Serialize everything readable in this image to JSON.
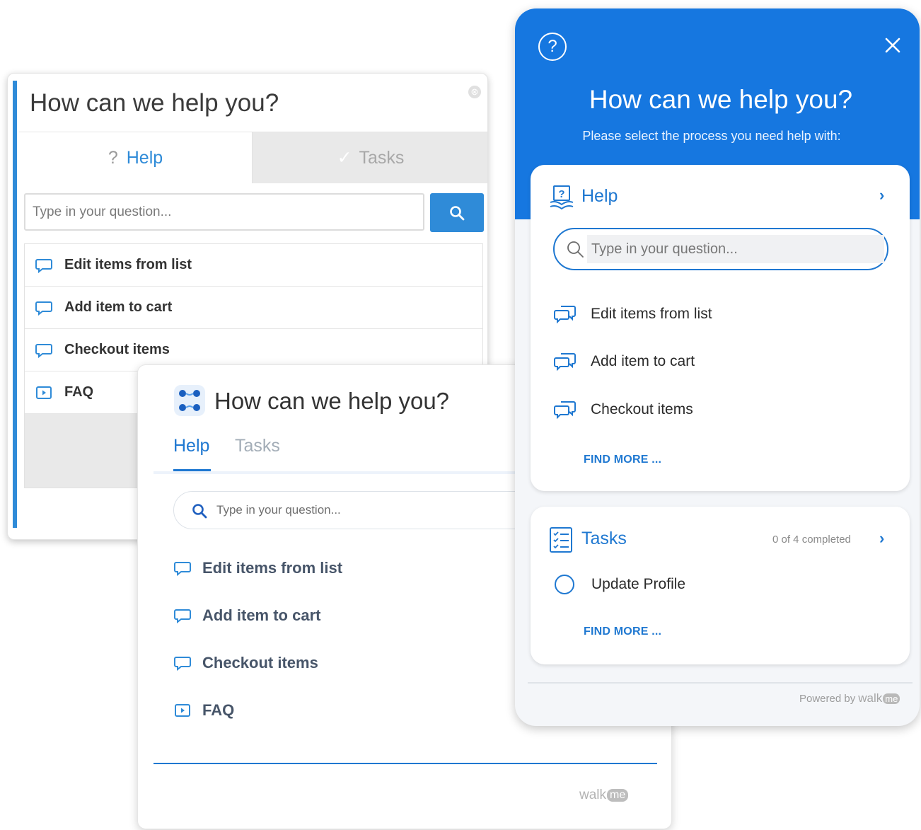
{
  "panel_classic": {
    "title": "How can we help you?",
    "close_glyph": "⊗",
    "tabs": {
      "help": {
        "icon": "?",
        "label": "Help"
      },
      "tasks": {
        "icon": "✓",
        "label": "Tasks"
      }
    },
    "search": {
      "placeholder": "Type in your question..."
    },
    "items": [
      {
        "label": "Edit items from list",
        "icon": "chat-bubble-icon"
      },
      {
        "label": "Add item to cart",
        "icon": "chat-bubble-icon"
      },
      {
        "label": "Checkout items",
        "icon": "chat-bubble-icon"
      },
      {
        "label": "FAQ",
        "icon": "play-box-icon"
      }
    ],
    "colors": {
      "accent": "#2f8bd8"
    }
  },
  "panel_modern": {
    "title": "How can we help you?",
    "tabs": {
      "help": "Help",
      "tasks": "Tasks"
    },
    "search": {
      "placeholder": "Type in your question..."
    },
    "items": [
      {
        "label": "Edit items from list",
        "icon": "chat-bubble-icon"
      },
      {
        "label": "Add item to cart",
        "icon": "chat-bubble-icon"
      },
      {
        "label": "Checkout items",
        "icon": "chat-bubble-icon"
      },
      {
        "label": "FAQ",
        "icon": "play-box-icon"
      }
    ],
    "brand": {
      "walk": "walk",
      "me": "me"
    },
    "colors": {
      "accent": "#1f78d1"
    }
  },
  "panel_blue": {
    "title": "How can we help you?",
    "subtitle": "Please select the process you need help with:",
    "help_card": {
      "title": "Help",
      "chevron": "›",
      "search": {
        "placeholder": "Type in your question..."
      },
      "items": [
        {
          "label": "Edit items from list",
          "icon": "chat-bubbles-icon"
        },
        {
          "label": "Add item to cart",
          "icon": "chat-bubbles-icon"
        },
        {
          "label": "Checkout items",
          "icon": "chat-bubbles-icon"
        }
      ],
      "find_more": "FIND MORE ..."
    },
    "tasks_card": {
      "title": "Tasks",
      "count": "0 of 4 completed",
      "chevron": "›",
      "tasks": [
        {
          "label": "Update Profile"
        }
      ],
      "find_more": "FIND MORE ..."
    },
    "footer": {
      "powered_by": "Powered by",
      "walk": "walk",
      "me": "me"
    },
    "colors": {
      "header": "#1677e0",
      "accent": "#1f78d1"
    }
  }
}
